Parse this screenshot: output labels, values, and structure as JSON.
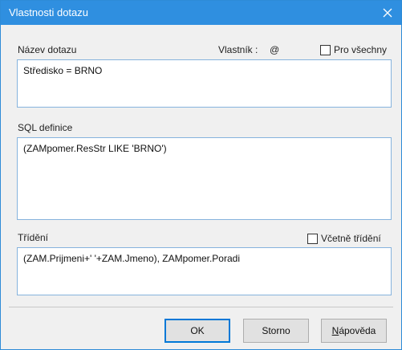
{
  "window": {
    "title": "Vlastnosti dotazu",
    "close_glyph": "close-icon"
  },
  "name_section": {
    "label": "Název dotazu",
    "owner_label": "Vlastník :",
    "owner_value": "@",
    "for_all_label": "Pro všechny",
    "for_all_checked": false,
    "value": "Středisko = BRNO"
  },
  "sql_section": {
    "label": "SQL definice",
    "value": "(ZAMpomer.ResStr LIKE 'BRNO')"
  },
  "sort_section": {
    "label": "Třídění",
    "include_label": "Včetně třídění",
    "include_checked": false,
    "value": "(ZAM.Prijmeni+' '+ZAM.Jmeno), ZAMpomer.Poradi"
  },
  "buttons": {
    "ok_label": "OK",
    "cancel_label": "Storno",
    "help_accel": "N",
    "help_rest": "ápověda"
  },
  "colors": {
    "titlebar": "#2f8fe0",
    "dialog_bg": "#f0f0f0",
    "field_border": "#86b3dd",
    "default_button_border": "#0078d7"
  }
}
